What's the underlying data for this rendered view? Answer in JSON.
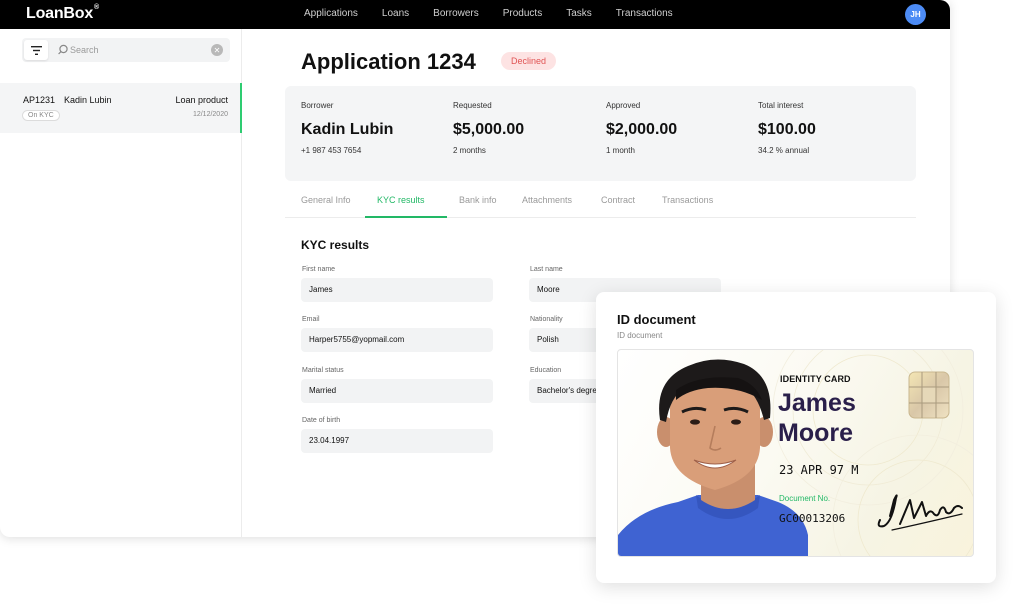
{
  "brand": {
    "name": "LoanBox",
    "mark": "®"
  },
  "nav": {
    "items": [
      "Applications",
      "Loans",
      "Borrowers",
      "Products",
      "Tasks",
      "Transactions"
    ]
  },
  "user": {
    "initials": "JH"
  },
  "sidebar": {
    "search_placeholder": "Search",
    "items": [
      {
        "id": "AP1231",
        "name": "Kadin Lubin",
        "product": "Loan product",
        "status": "On KYC",
        "date": "12/12/2020"
      }
    ]
  },
  "application": {
    "title": "Application 1234",
    "status": "Declined",
    "summary": [
      {
        "label": "Borrower",
        "value": "Kadin Lubin",
        "sub": "+1 987 453 7654"
      },
      {
        "label": "Requested",
        "value": "$5,000.00",
        "sub": "2 months"
      },
      {
        "label": "Approved",
        "value": "$2,000.00",
        "sub": "1 month"
      },
      {
        "label": "Total interest",
        "value": "$100.00",
        "sub": "34.2 % annual"
      }
    ]
  },
  "tabs": [
    "General Info",
    "KYC results",
    "Bank info",
    "Attachments",
    "Contract",
    "Transactions"
  ],
  "active_tab": "KYC results",
  "kyc": {
    "title": "KYC results",
    "fields": [
      {
        "label": "First name",
        "value": "James"
      },
      {
        "label": "Last name",
        "value": "Moore"
      },
      {
        "label": "Email",
        "value": "Harper5755@yopmail.com"
      },
      {
        "label": "Nationality",
        "value": "Polish"
      },
      {
        "label": "Marital status",
        "value": "Married"
      },
      {
        "label": "Education",
        "value": "Bachelor's degree"
      },
      {
        "label": "Date of birth",
        "value": "23.04.1997"
      }
    ]
  },
  "id_document": {
    "title": "ID document",
    "subtitle": "ID document",
    "card": {
      "heading": "IDENTITY CARD",
      "first_name": "James",
      "last_name": "Moore",
      "dob": "23 APR 97   M",
      "doc_label": "Document No.",
      "doc_number": "GC00013206",
      "signature": "J. Moore"
    }
  },
  "colors": {
    "accent": "#22b866",
    "declined_bg": "#fde3e3",
    "declined_text": "#e05454",
    "avatar": "#4d8cf5"
  }
}
